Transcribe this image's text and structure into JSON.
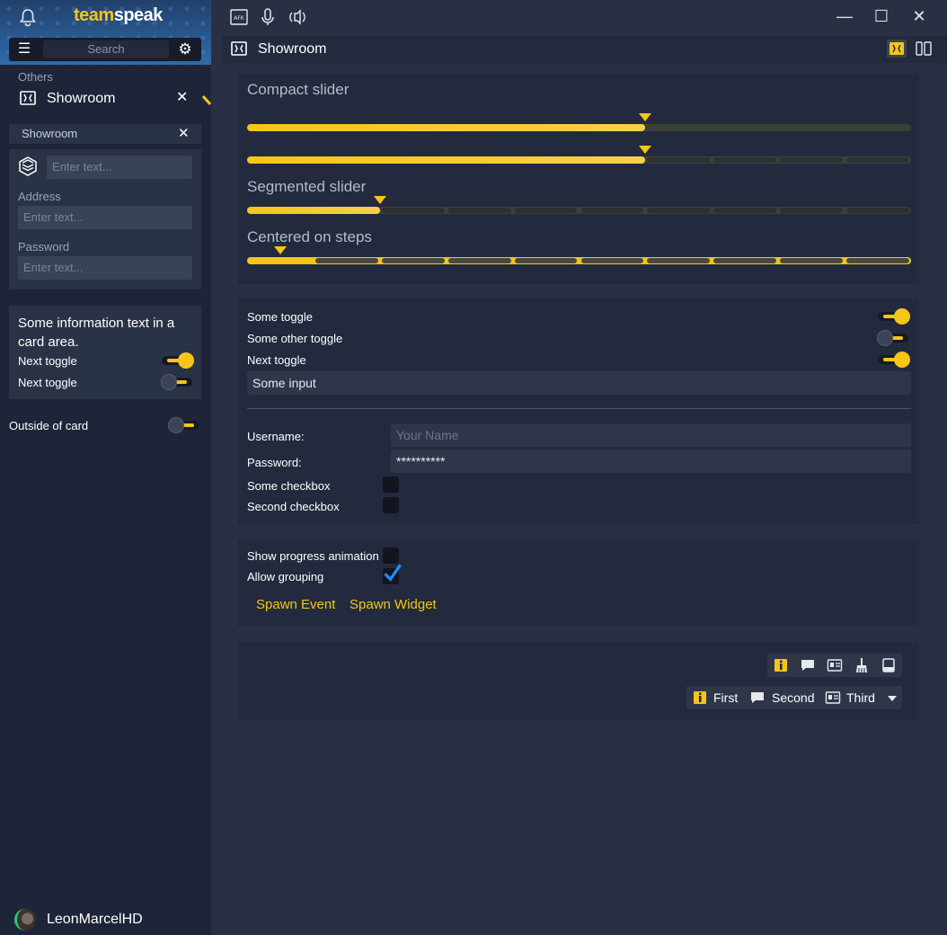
{
  "app": {
    "logo_part1": "team",
    "logo_part2": "speak"
  },
  "sidebar": {
    "search_placeholder": "Search",
    "section_label": "Others",
    "active_item": "Showroom",
    "tab_label": "Showroom",
    "form": {
      "name_placeholder": "Enter text...",
      "address_label": "Address",
      "address_placeholder": "Enter text...",
      "password_label": "Password",
      "password_placeholder": "Enter text..."
    },
    "card": {
      "info_text": "Some information text in a card area.",
      "toggle1_label": "Next toggle",
      "toggle1_on": true,
      "toggle2_label": "Next toggle",
      "toggle2_on": false
    },
    "outside_label": "Outside of card",
    "outside_on": false,
    "username": "LeonMarcelHD"
  },
  "topbar": {
    "icons": [
      "afk-icon",
      "microphone-icon",
      "speaker-icon"
    ]
  },
  "tab": {
    "title": "Showroom"
  },
  "sliders": {
    "compact_title": "Compact slider",
    "compact_value": 0.6,
    "segmented_title": "Segmented slider",
    "segmented_value": 0.2,
    "centered_title": "Centered on steps",
    "centered_value": 0.05,
    "segments": 10
  },
  "toggles": {
    "t1": {
      "label": "Some toggle",
      "on": true
    },
    "t2": {
      "label": "Some other toggle",
      "on": false
    },
    "t3": {
      "label": "Next toggle",
      "on": true
    },
    "input_value": "Some input"
  },
  "login": {
    "username_label": "Username:",
    "username_placeholder": "Your Name",
    "password_label": "Password:",
    "password_value": "**********",
    "checkbox1_label": "Some checkbox",
    "checkbox2_label": "Second checkbox"
  },
  "events": {
    "progress_label": "Show progress animation",
    "grouping_label": "Allow grouping",
    "spawn_event": "Spawn Event",
    "spawn_widget": "Spawn Widget"
  },
  "segmented": {
    "first": "First",
    "second": "Second",
    "third": "Third"
  },
  "colors": {
    "accent": "#f5c518",
    "bg": "#2a3043",
    "panel": "#232a3d",
    "check": "#1e90ff"
  }
}
